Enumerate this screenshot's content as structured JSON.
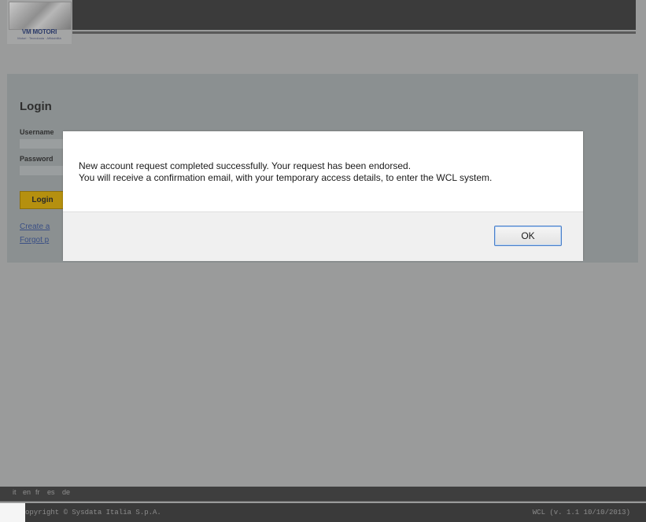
{
  "header": {
    "logo_text": "VM MOTORI",
    "logo_tagline": "Motori · Tecnologia · Affidabilità"
  },
  "login": {
    "title": "Login",
    "username_label": "Username",
    "password_label": "Password",
    "login_button": "Login",
    "create_link": "Create a",
    "forgot_link": "Forgot p"
  },
  "dialog": {
    "message_line1": "New account request completed successfully. Your request has been endorsed.",
    "message_line2": "You will receive a confirmation email, with your temporary access details, to enter the WCL system.",
    "ok_button": "OK"
  },
  "footer": {
    "languages": [
      "it",
      "en",
      "fr",
      "es",
      "de"
    ],
    "copyright": "opyright © Sysdata Italia S.p.A.",
    "version": "WCL (v. 1.1 10/10/2013)"
  },
  "colors": {
    "overlay_gray": "#9a9b9b",
    "login_button": "#b5900f",
    "ok_focus_border": "#4a7fc9"
  }
}
